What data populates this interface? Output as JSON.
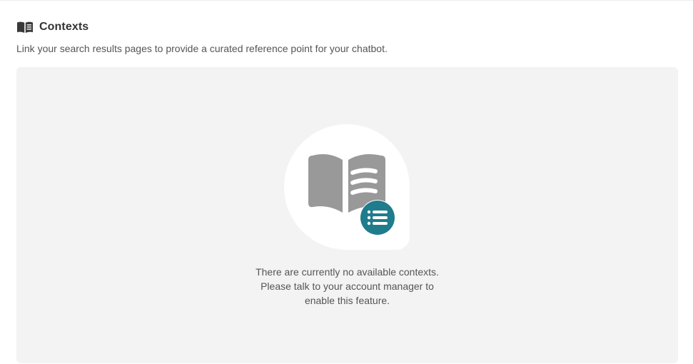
{
  "section": {
    "title": "Contexts",
    "icon": "open-book-icon",
    "description": "Link your search results pages to provide a curated reference point for your chatbot."
  },
  "empty_state": {
    "illustration_icon": "open-book-icon",
    "badge_icon": "list-icon",
    "message_lines": [
      "There are currently no available contexts.",
      "Please talk to your account manager to",
      "enable this feature."
    ]
  },
  "colors": {
    "accent": "#1f7c8c",
    "icon_gray": "#999999",
    "area_background": "#f3f3f3"
  }
}
